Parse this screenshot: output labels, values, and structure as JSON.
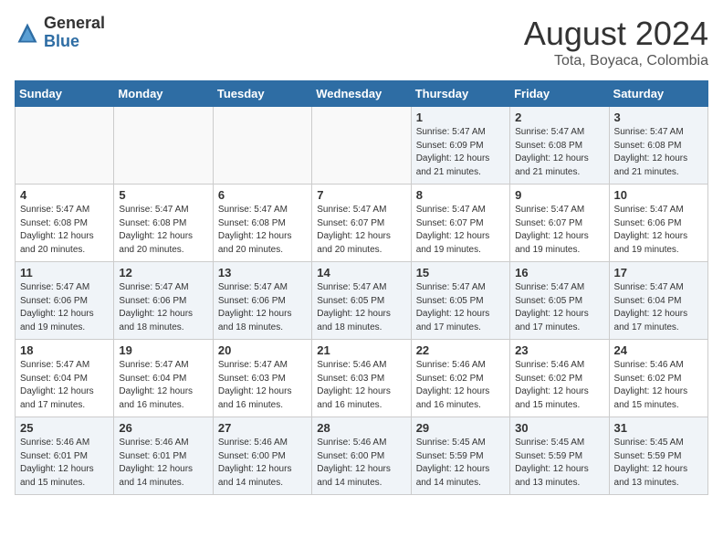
{
  "header": {
    "logo_general": "General",
    "logo_blue": "Blue",
    "month_title": "August 2024",
    "location": "Tota, Boyaca, Colombia"
  },
  "days_of_week": [
    "Sunday",
    "Monday",
    "Tuesday",
    "Wednesday",
    "Thursday",
    "Friday",
    "Saturday"
  ],
  "weeks": [
    [
      {
        "num": "",
        "info": ""
      },
      {
        "num": "",
        "info": ""
      },
      {
        "num": "",
        "info": ""
      },
      {
        "num": "",
        "info": ""
      },
      {
        "num": "1",
        "info": "Sunrise: 5:47 AM\nSunset: 6:09 PM\nDaylight: 12 hours\nand 21 minutes."
      },
      {
        "num": "2",
        "info": "Sunrise: 5:47 AM\nSunset: 6:08 PM\nDaylight: 12 hours\nand 21 minutes."
      },
      {
        "num": "3",
        "info": "Sunrise: 5:47 AM\nSunset: 6:08 PM\nDaylight: 12 hours\nand 21 minutes."
      }
    ],
    [
      {
        "num": "4",
        "info": "Sunrise: 5:47 AM\nSunset: 6:08 PM\nDaylight: 12 hours\nand 20 minutes."
      },
      {
        "num": "5",
        "info": "Sunrise: 5:47 AM\nSunset: 6:08 PM\nDaylight: 12 hours\nand 20 minutes."
      },
      {
        "num": "6",
        "info": "Sunrise: 5:47 AM\nSunset: 6:08 PM\nDaylight: 12 hours\nand 20 minutes."
      },
      {
        "num": "7",
        "info": "Sunrise: 5:47 AM\nSunset: 6:07 PM\nDaylight: 12 hours\nand 20 minutes."
      },
      {
        "num": "8",
        "info": "Sunrise: 5:47 AM\nSunset: 6:07 PM\nDaylight: 12 hours\nand 19 minutes."
      },
      {
        "num": "9",
        "info": "Sunrise: 5:47 AM\nSunset: 6:07 PM\nDaylight: 12 hours\nand 19 minutes."
      },
      {
        "num": "10",
        "info": "Sunrise: 5:47 AM\nSunset: 6:06 PM\nDaylight: 12 hours\nand 19 minutes."
      }
    ],
    [
      {
        "num": "11",
        "info": "Sunrise: 5:47 AM\nSunset: 6:06 PM\nDaylight: 12 hours\nand 19 minutes."
      },
      {
        "num": "12",
        "info": "Sunrise: 5:47 AM\nSunset: 6:06 PM\nDaylight: 12 hours\nand 18 minutes."
      },
      {
        "num": "13",
        "info": "Sunrise: 5:47 AM\nSunset: 6:06 PM\nDaylight: 12 hours\nand 18 minutes."
      },
      {
        "num": "14",
        "info": "Sunrise: 5:47 AM\nSunset: 6:05 PM\nDaylight: 12 hours\nand 18 minutes."
      },
      {
        "num": "15",
        "info": "Sunrise: 5:47 AM\nSunset: 6:05 PM\nDaylight: 12 hours\nand 17 minutes."
      },
      {
        "num": "16",
        "info": "Sunrise: 5:47 AM\nSunset: 6:05 PM\nDaylight: 12 hours\nand 17 minutes."
      },
      {
        "num": "17",
        "info": "Sunrise: 5:47 AM\nSunset: 6:04 PM\nDaylight: 12 hours\nand 17 minutes."
      }
    ],
    [
      {
        "num": "18",
        "info": "Sunrise: 5:47 AM\nSunset: 6:04 PM\nDaylight: 12 hours\nand 17 minutes."
      },
      {
        "num": "19",
        "info": "Sunrise: 5:47 AM\nSunset: 6:04 PM\nDaylight: 12 hours\nand 16 minutes."
      },
      {
        "num": "20",
        "info": "Sunrise: 5:47 AM\nSunset: 6:03 PM\nDaylight: 12 hours\nand 16 minutes."
      },
      {
        "num": "21",
        "info": "Sunrise: 5:46 AM\nSunset: 6:03 PM\nDaylight: 12 hours\nand 16 minutes."
      },
      {
        "num": "22",
        "info": "Sunrise: 5:46 AM\nSunset: 6:02 PM\nDaylight: 12 hours\nand 16 minutes."
      },
      {
        "num": "23",
        "info": "Sunrise: 5:46 AM\nSunset: 6:02 PM\nDaylight: 12 hours\nand 15 minutes."
      },
      {
        "num": "24",
        "info": "Sunrise: 5:46 AM\nSunset: 6:02 PM\nDaylight: 12 hours\nand 15 minutes."
      }
    ],
    [
      {
        "num": "25",
        "info": "Sunrise: 5:46 AM\nSunset: 6:01 PM\nDaylight: 12 hours\nand 15 minutes."
      },
      {
        "num": "26",
        "info": "Sunrise: 5:46 AM\nSunset: 6:01 PM\nDaylight: 12 hours\nand 14 minutes."
      },
      {
        "num": "27",
        "info": "Sunrise: 5:46 AM\nSunset: 6:00 PM\nDaylight: 12 hours\nand 14 minutes."
      },
      {
        "num": "28",
        "info": "Sunrise: 5:46 AM\nSunset: 6:00 PM\nDaylight: 12 hours\nand 14 minutes."
      },
      {
        "num": "29",
        "info": "Sunrise: 5:45 AM\nSunset: 5:59 PM\nDaylight: 12 hours\nand 14 minutes."
      },
      {
        "num": "30",
        "info": "Sunrise: 5:45 AM\nSunset: 5:59 PM\nDaylight: 12 hours\nand 13 minutes."
      },
      {
        "num": "31",
        "info": "Sunrise: 5:45 AM\nSunset: 5:59 PM\nDaylight: 12 hours\nand 13 minutes."
      }
    ]
  ]
}
